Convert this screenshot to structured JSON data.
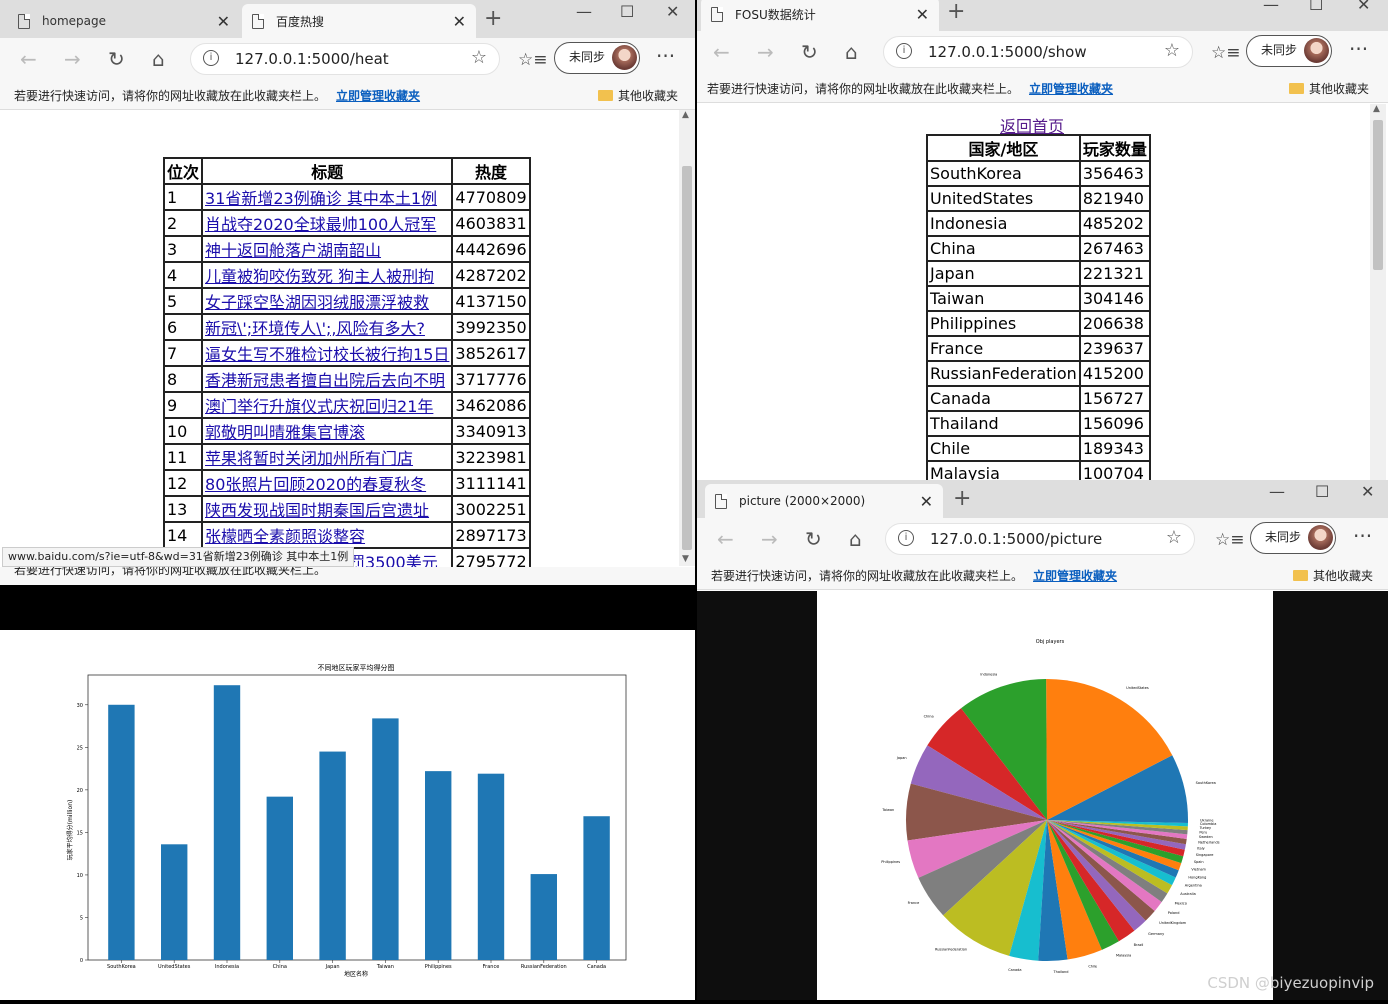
{
  "heat_window": {
    "tabs": [
      {
        "title": "homepage"
      },
      {
        "title": "百度热搜"
      }
    ],
    "url": "127.0.0.1:5000/heat",
    "sync_label": "未同步",
    "favbar_msg": "若要进行快速访问，请将你的网址收藏放在此收藏夹栏上。",
    "favbar_link": "立即管理收藏夹",
    "other_favs": "其他收藏夹",
    "table": {
      "headers": [
        "位次",
        "标题",
        "热度"
      ],
      "rows": [
        [
          "1",
          "31省新增23例确诊 其中本土1例",
          "4770809"
        ],
        [
          "2",
          "肖战夺2020全球最帅100人冠军",
          "4603831"
        ],
        [
          "3",
          "神十返回舱落户湖南韶山",
          "4442696"
        ],
        [
          "4",
          "儿童被狗咬伤致死 狗主人被刑拘",
          "4287202"
        ],
        [
          "5",
          "女子踩空坠湖因羽绒服漂浮被救",
          "4137150"
        ],
        [
          "6",
          "新冠\\';环境传人\\';,风险有多大?",
          "3992350"
        ],
        [
          "7",
          "逼女生写不雅检讨校长被行拘15日",
          "3852617"
        ],
        [
          "8",
          "香港新冠患者擅自出院后去向不明",
          "3717776"
        ],
        [
          "9",
          "澳门举行升旗仪式庆祝回归21年",
          "3462086"
        ],
        [
          "10",
          "郭敬明叫晴雅集官博滚",
          "3340913"
        ],
        [
          "11",
          "苹果将暂时关闭加州所有门店",
          "3223981"
        ],
        [
          "12",
          "80张照片回顾2020的春夏秋冬",
          "3111141"
        ],
        [
          "13",
          "陕西发现战国时期秦国后宫遗址",
          "3002251"
        ],
        [
          "14",
          "张檬晒全素颜照谈整容",
          "2897173"
        ],
        [
          "15",
          "智利总统不戴口罩被罚3500美元",
          "2795772"
        ]
      ]
    },
    "status_url": "www.baidu.com/s?ie=utf-8&wd=31省新增23例确诊 其中本土1例"
  },
  "show_window": {
    "tab_title": "FOSU数据统计",
    "url": "127.0.0.1:5000/show",
    "sync_label": "未同步",
    "favbar_msg": "若要进行快速访问，请将你的网址收藏放在此收藏夹栏上。",
    "favbar_link": "立即管理收藏夹",
    "other_favs": "其他收藏夹",
    "back_link": "返回首页",
    "table": {
      "headers": [
        "国家/地区",
        "玩家数量"
      ],
      "rows": [
        [
          "SouthKorea",
          "356463"
        ],
        [
          "UnitedStates",
          "821940"
        ],
        [
          "Indonesia",
          "485202"
        ],
        [
          "China",
          "267463"
        ],
        [
          "Japan",
          "221321"
        ],
        [
          "Taiwan",
          "304146"
        ],
        [
          "Philippines",
          "206638"
        ],
        [
          "France",
          "239637"
        ],
        [
          "RussianFederation",
          "415200"
        ],
        [
          "Canada",
          "156727"
        ],
        [
          "Thailand",
          "156096"
        ],
        [
          "Chile",
          "189343"
        ],
        [
          "Malaysia",
          "100704"
        ]
      ]
    }
  },
  "picture_window": {
    "tab_title": "picture (2000×2000)",
    "url": "127.0.0.1:5000/picture",
    "sync_label": "未同步",
    "favbar_msg": "若要进行快速访问，请将你的网址收藏放在此收藏夹栏上。",
    "favbar_link": "立即管理收藏夹",
    "other_favs": "其他收藏夹"
  },
  "chart_data": [
    {
      "type": "bar",
      "title": "不同地区玩家平均得分图",
      "xlabel": "地区名称",
      "ylabel": "玩家平均得分(million)",
      "categories": [
        "SouthKorea",
        "UnitedStates",
        "Indonesia",
        "China",
        "Japan",
        "Taiwan",
        "Philippines",
        "France",
        "RussianFederation",
        "Canada"
      ],
      "values": [
        30,
        13.6,
        32.3,
        19.2,
        24.5,
        28.4,
        22.2,
        21.9,
        10.1,
        16.9
      ],
      "ylim": [
        0,
        33.5
      ],
      "yticks": [
        0,
        5,
        10,
        15,
        20,
        25,
        30
      ],
      "color": "#1f77b4"
    },
    {
      "type": "pie",
      "title": "Obj players",
      "labels": [
        "SouthKorea",
        "UnitedStates",
        "Indonesia",
        "China",
        "Japan",
        "Taiwan",
        "Philippines",
        "France",
        "RussianFederation",
        "Canada",
        "Thailand",
        "Chile",
        "Malaysia",
        "Brazil",
        "Germany",
        "UnitedKingdom",
        "Poland",
        "Mexico",
        "Australia",
        "Argentina",
        "HongKong",
        "Vietnam",
        "Spain",
        "Singapore",
        "Italy",
        "Netherlands",
        "Sweden",
        "Peru",
        "Turkey",
        "Colombia",
        "Ukraine"
      ],
      "values": [
        356463,
        821940,
        485202,
        267463,
        221321,
        304146,
        206638,
        239637,
        415200,
        156727,
        156096,
        189343,
        100704,
        100000,
        80000,
        70000,
        60000,
        55000,
        50000,
        45000,
        42000,
        40000,
        38000,
        35000,
        30000,
        28000,
        25000,
        22000,
        20000,
        18000,
        16000
      ],
      "colors": [
        "#1f77b4",
        "#ff7f0e",
        "#2ca02c",
        "#d62728",
        "#9467bd",
        "#8c564b",
        "#e377c2",
        "#7f7f7f",
        "#bcbd22",
        "#17becf"
      ]
    }
  ],
  "watermark": "CSDN @biyezuopinvip"
}
